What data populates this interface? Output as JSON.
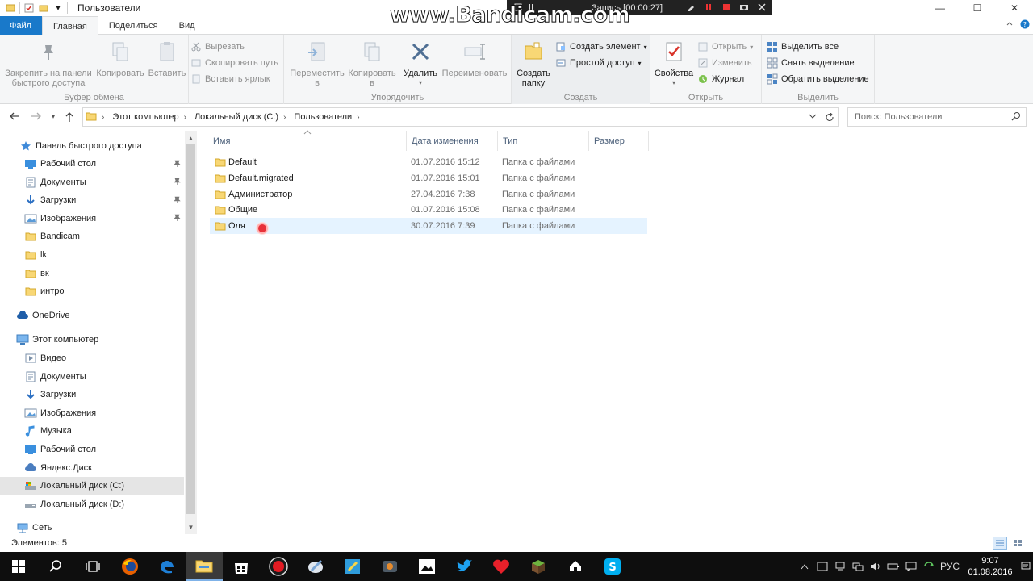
{
  "window": {
    "title": "Пользователи",
    "controls": [
      "—",
      "☐",
      "✕"
    ]
  },
  "overlay": {
    "brand": "www.Bandicam.com",
    "record_text": "Запись [00:00:27]"
  },
  "tabs": [
    "Файл",
    "Главная",
    "Поделиться",
    "Вид"
  ],
  "ribbon": {
    "clipboard": {
      "label": "Буфер обмена",
      "pin": "Закрепить на панели быстрого доступа",
      "pin_l1": "Закрепить на панели",
      "pin_l2": "быстрого доступа",
      "copy": "Копировать",
      "paste": "Вставить",
      "cut": "Вырезать",
      "copy_path": "Скопировать путь",
      "paste_shortcut": "Вставить ярлык"
    },
    "organize": {
      "label": "Упорядочить",
      "move_l1": "Переместить",
      "move_l2": "в",
      "copy_l1": "Копировать",
      "copy_l2": "в",
      "delete": "Удалить",
      "rename": "Переименовать"
    },
    "create": {
      "label": "Создать",
      "new_folder_l1": "Создать",
      "new_folder_l2": "папку",
      "new_item": "Создать элемент",
      "easy_access": "Простой доступ"
    },
    "open": {
      "label": "Открыть",
      "properties": "Свойства",
      "open": "Открыть",
      "edit": "Изменить",
      "history": "Журнал"
    },
    "select": {
      "label": "Выделить",
      "select_all": "Выделить все",
      "select_none": "Снять выделение",
      "invert": "Обратить выделение"
    }
  },
  "address": {
    "crumbs": [
      "Этот компьютер",
      "Локальный диск (C:)",
      "Пользователи"
    ],
    "search_placeholder": "Поиск: Пользователи"
  },
  "nav": {
    "quick_access": "Панель быстрого доступа",
    "quick_items": [
      "Рабочий стол",
      "Документы",
      "Загрузки",
      "Изображения",
      "Bandicam",
      "lk",
      "вк",
      "интро"
    ],
    "onedrive": "OneDrive",
    "this_pc": "Этот компьютер",
    "pc_items": [
      "Видео",
      "Документы",
      "Загрузки",
      "Изображения",
      "Музыка",
      "Рабочий стол",
      "Яндекс.Диск",
      "Локальный диск (C:)",
      "Локальный диск (D:)"
    ],
    "network": "Сеть"
  },
  "columns": [
    "Имя",
    "Дата изменения",
    "Тип",
    "Размер"
  ],
  "files": [
    {
      "name": "Default",
      "date": "01.07.2016 15:12",
      "type": "Папка с файлами"
    },
    {
      "name": "Default.migrated",
      "date": "01.07.2016 15:01",
      "type": "Папка с файлами"
    },
    {
      "name": "Администратор",
      "date": "27.04.2016 7:38",
      "type": "Папка с файлами"
    },
    {
      "name": "Общие",
      "date": "01.07.2016 15:08",
      "type": "Папка с файлами"
    },
    {
      "name": "Оля",
      "date": "30.07.2016 7:39",
      "type": "Папка с файлами"
    }
  ],
  "status": {
    "count": "Элементов: 5"
  },
  "taskbar": {
    "lang": "РУС",
    "time": "9:07",
    "date": "01.08.2016"
  },
  "colors": {
    "accent": "#1979ca",
    "folder": "#f8d775",
    "selection": "#cce8ff",
    "row_hover": "#e5f3ff"
  }
}
